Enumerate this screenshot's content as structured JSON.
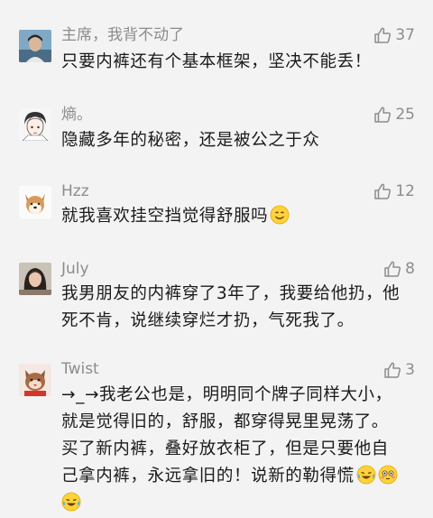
{
  "comments": [
    {
      "username": "主席，我背不动了",
      "likes": "37",
      "lines": [
        "只要内裤还有个基本框架，坚决不能丢！"
      ],
      "avatar_icon": "person-photo-avatar-icon"
    },
    {
      "username": "熵。",
      "likes": "25",
      "lines": [
        "隐藏多年的秘密，还是被公之于众"
      ],
      "avatar_icon": "sketch-face-avatar-icon"
    },
    {
      "username": "Hzz",
      "likes": "12",
      "lines": [
        "就我喜欢挂空挡觉得舒服吗"
      ],
      "avatar_icon": "shiba-dog-avatar-icon",
      "emoji": [
        "smile-emoji"
      ]
    },
    {
      "username": "July",
      "likes": "8",
      "lines": [
        "我男朋友的内裤穿了3年了，我要给他扔，他",
        "死不肯，说继续穿烂才扔，气死我了。"
      ],
      "avatar_icon": "girl-photo-avatar-icon"
    },
    {
      "username": "Twist",
      "likes": "3",
      "lines": [
        "→_→我老公也是，明明同个牌子同样大小，",
        "就是觉得旧的，舒服，都穿得晃里晃荡了。",
        "买了新内裤，叠好放衣柜了，但是只要他自",
        "己拿内裤，永远拿旧的！说新的勒得慌"
      ],
      "avatar_icon": "cartoon-cat-avatar-icon",
      "emoji": [
        "laugh-cry-emoji",
        "flushed-emoji",
        "laugh-cry-emoji"
      ]
    }
  ],
  "colors": {
    "background": "#f3f3f3",
    "meta_text": "#8c8c8c",
    "body_text": "#1a1a1a"
  }
}
